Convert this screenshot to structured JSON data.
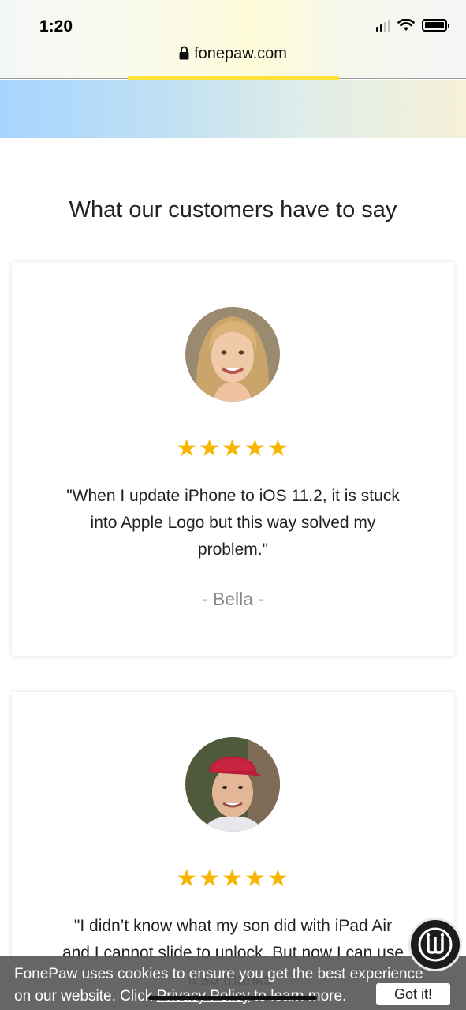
{
  "status_bar": {
    "time": "1:20"
  },
  "browser": {
    "url": "fonepaw.com"
  },
  "section": {
    "heading": "What our customers have to say"
  },
  "testimonials": [
    {
      "stars": "★★★★★",
      "rating": 5,
      "quote": "\"When I update iPhone to iOS 11.2, it is stuck into Apple Logo but this way solved my problem.\"",
      "author": "- Bella -"
    },
    {
      "stars": "★★★★★",
      "rating": 5,
      "quote": "\"I didn’t know what my son did with iPad Air and I cannot slide to unlock. But now I can use it so thanks\""
    }
  ],
  "cookie_banner": {
    "text_line1": "FonePaw uses cookies to ensure you get the best experience",
    "text_line2_prefix": "on our website. Click ",
    "link": "Privacy Policy",
    "text_line2_suffix": " to learn more.",
    "button": "Got it!"
  },
  "icons": {
    "lock": "lock-icon",
    "wifi": "wifi-icon",
    "signal": "signal-icon",
    "battery": "battery-icon",
    "star": "star-icon",
    "chat": "chat-widget-icon"
  },
  "colors": {
    "star": "#f7b500",
    "cookie_bg": "#5a5a5a",
    "banner_yellow": "#ffe23a"
  }
}
